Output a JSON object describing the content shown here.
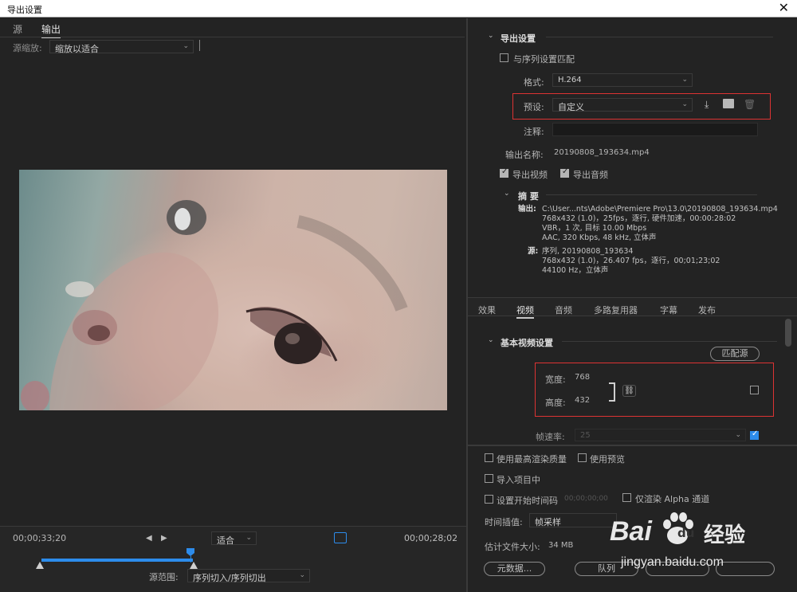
{
  "window": {
    "title": "导出设置",
    "close": "✕"
  },
  "left": {
    "tabs": [
      "源",
      "输出"
    ],
    "source_scale_label": "源缩放:",
    "source_scale_value": "缩放以适合",
    "timeline": {
      "current_time": "00;00;33;20",
      "zoom_value": "适合",
      "duration": "00;00;28;02",
      "range_label": "源范围:",
      "range_value": "序列切入/序列切出"
    }
  },
  "right": {
    "export_settings_title": "导出设置",
    "match_sequence_label": "与序列设置匹配",
    "format_label": "格式:",
    "format_value": "H.264",
    "preset_label": "预设:",
    "preset_value": "自定义",
    "comments_label": "注释:",
    "output_name_label": "输出名称:",
    "output_name_value": "20190808_193634.mp4",
    "export_video_label": "导出视频",
    "export_audio_label": "导出音频",
    "summary_title": "摘 要",
    "summary": {
      "output_label": "输出:",
      "output_lines": [
        "C:\\User...nts\\Adobe\\Premiere Pro\\13.0\\20190808_193634.mp4",
        "768x432 (1.0)，25fps，逐行, 硬件加速，00:00:28:02",
        "VBR，1 次, 目标 10.00 Mbps",
        "AAC, 320 Kbps, 48 kHz, 立体声"
      ],
      "source_label": "源:",
      "source_lines": [
        "序列, 20190808_193634",
        "768x432 (1.0)，26.407 fps，逐行，00;01;23;02",
        "44100 Hz，立体声"
      ]
    },
    "tabs": [
      "效果",
      "视频",
      "音频",
      "多路复用器",
      "字幕",
      "发布"
    ],
    "basic_video_title": "基本视频设置",
    "match_source_button": "匹配源",
    "width_label": "宽度:",
    "width_value": "768",
    "height_label": "高度:",
    "height_value": "432",
    "frame_rate_label": "帧速率:",
    "frame_rate_value": "25",
    "bottom": {
      "max_render_quality": "使用最高渲染质量",
      "use_previews": "使用预览",
      "import_into_project": "导入项目中",
      "set_start_timecode": "设置开始时间码",
      "start_timecode_value": "00;00;00;00",
      "render_alpha_only": "仅渲染 Alpha 通道",
      "time_interpolation_label": "时间插值:",
      "time_interpolation_value": "帧采样",
      "estimated_size_label": "估计文件大小:",
      "estimated_size_value": "34 MB",
      "metadata_button": "元数据...",
      "queue_button": "队列"
    }
  },
  "watermark": {
    "brand": "Bai",
    "brand2": "du",
    "cn": "经验",
    "url": "jingyan.baidu.com"
  },
  "colors": {
    "accent_blue": "#2d8ceb",
    "highlight_red": "#dd3333",
    "panel_bg": "#232323"
  }
}
